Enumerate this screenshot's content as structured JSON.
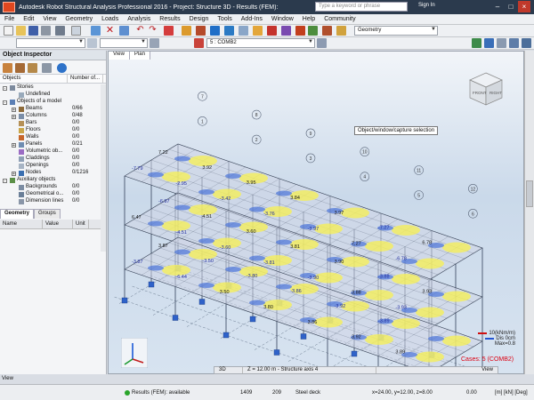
{
  "window": {
    "title": "Autodesk Robot Structural Analysis Professional 2016 - Project: Structure 3D - Results (FEM): available",
    "search_placeholder": "Type a keyword or phrase",
    "sign_in": "Sign In"
  },
  "menu": [
    "File",
    "Edit",
    "View",
    "Geometry",
    "Loads",
    "Analysis",
    "Results",
    "Design",
    "Tools",
    "Add-Ins",
    "Window",
    "Help",
    "Community"
  ],
  "toolbar": {
    "layout_select": "Geometry",
    "case_select": "5 : COMB2"
  },
  "inspector": {
    "title": "Object Inspector",
    "columns": [
      "Objects",
      "Number of..."
    ],
    "tree": [
      {
        "label": "Stories",
        "num": "",
        "level": 0,
        "exp": "-"
      },
      {
        "label": "Undefined",
        "num": "",
        "level": 1,
        "exp": ""
      },
      {
        "label": "Objects of a model",
        "num": "",
        "level": 0,
        "exp": "-"
      },
      {
        "label": "Beams",
        "num": "0/66",
        "level": 1,
        "exp": "+"
      },
      {
        "label": "Columns",
        "num": "0/48",
        "level": 1,
        "exp": "+"
      },
      {
        "label": "Bars",
        "num": "0/0",
        "level": 1,
        "exp": ""
      },
      {
        "label": "Floors",
        "num": "0/0",
        "level": 1,
        "exp": ""
      },
      {
        "label": "Walls",
        "num": "0/0",
        "level": 1,
        "exp": ""
      },
      {
        "label": "Panels",
        "num": "0/21",
        "level": 1,
        "exp": "+"
      },
      {
        "label": "Volumetric ob...",
        "num": "0/0",
        "level": 1,
        "exp": ""
      },
      {
        "label": "Claddings",
        "num": "0/0",
        "level": 1,
        "exp": ""
      },
      {
        "label": "Openings",
        "num": "0/0",
        "level": 1,
        "exp": ""
      },
      {
        "label": "Nodes",
        "num": "0/1216",
        "level": 1,
        "exp": "+"
      },
      {
        "label": "Auxiliary objects",
        "num": "",
        "level": 0,
        "exp": "-"
      },
      {
        "label": "Backgrounds",
        "num": "0/0",
        "level": 1,
        "exp": ""
      },
      {
        "label": "Geometrical o...",
        "num": "0/0",
        "level": 1,
        "exp": ""
      },
      {
        "label": "Dimension lines",
        "num": "0/0",
        "level": 1,
        "exp": ""
      }
    ],
    "tabs": [
      "Geometry",
      "Groups"
    ],
    "prop_columns": [
      "Name",
      "Value",
      "Unit"
    ]
  },
  "viewport": {
    "tabs": [
      "View",
      "Plan"
    ],
    "tooltip": "Object/window/capture selection",
    "viewcube": {
      "front": "FRONT",
      "right": "RIGHT"
    },
    "grid_labels": [
      "1",
      "2",
      "3",
      "4",
      "5",
      "6",
      "7",
      "8",
      "9",
      "10",
      "11",
      "12"
    ],
    "values": [
      "-7.79",
      "7.22",
      "-2.95",
      "3.92",
      "-3.42",
      "3.95",
      "-3.76",
      "3.84",
      "-3.97",
      "3.97",
      "7.27",
      "-7.27",
      "-6.78",
      "6.78",
      "6.47",
      "-6.97",
      "-4.51",
      "4.51",
      "-3.60",
      "3.60",
      "-3.81",
      "3.81",
      "-3.90",
      "3.90",
      "3.88",
      "-3.88",
      "-3.93",
      "3.93",
      "-3.87",
      "3.87",
      "-6.44",
      "-3.50",
      "3.50",
      "-3.80",
      "3.80",
      "-3.86",
      "3.86",
      "-3.92",
      "3.92",
      "-3.89",
      "3.89"
    ],
    "legend": {
      "moment": "10(kNm/m)",
      "dis": "Dis 0cm",
      "max": "Max=0.8"
    },
    "cases": "Cases: 5 (COMB2)"
  },
  "view_status": {
    "mode": "3D",
    "position": "Z = 12.00 m - Structure axis 4",
    "view_label": "View"
  },
  "statusbar": {
    "results": "Results (FEM): available",
    "nodes": "1409",
    "bars": "209",
    "section": "Steel deck",
    "coords": "x=24.00, y=12.00, z=8.00",
    "angle": "0.00",
    "units": "[m] [kN] [Deg]"
  },
  "bottom_label": "View",
  "colors": {
    "accent": "#e0471f",
    "yellow": "#f5ef5a",
    "blue": "#4a73d8",
    "red": "#d01010"
  }
}
